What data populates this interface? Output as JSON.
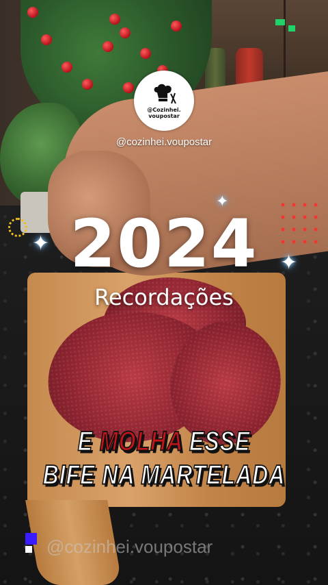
{
  "logo": {
    "name_line1": "@Cozinhei.",
    "name_line2": "voupostar",
    "icon": "chef-hat-with-utensils-icon"
  },
  "profile_handle": "@cozinhei.voupostar",
  "banner": {
    "year": "2024",
    "subtitle": "Recordações"
  },
  "caption": {
    "line1_part1": "E ",
    "line1_highlight": "MOLHA",
    "line1_part2": " ESSE",
    "line2": "BIFE NA MARTELADA"
  },
  "watermark": "@cozinhei.voupostar",
  "colors": {
    "highlight_red": "#c4141b",
    "watermark_square": "#3b1cff",
    "pixel_accent": "#1fd36a"
  }
}
